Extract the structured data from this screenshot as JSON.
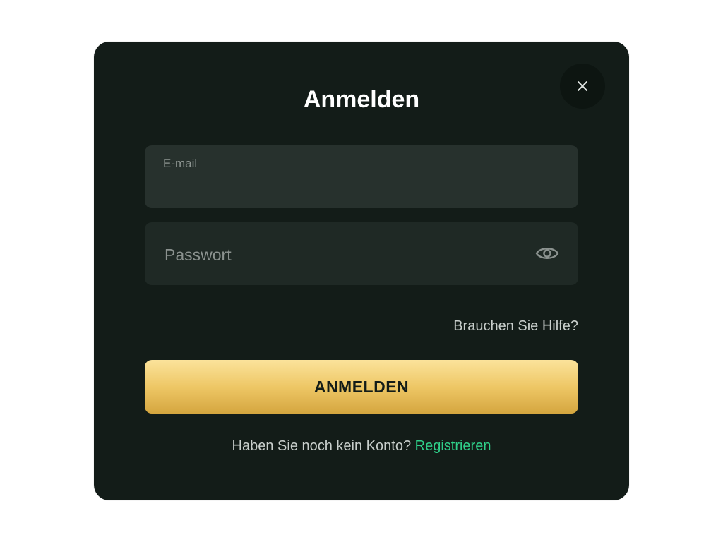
{
  "modal": {
    "title": "Anmelden",
    "close_icon": "close-icon"
  },
  "email": {
    "label": "E-mail",
    "value": "",
    "placeholder": ""
  },
  "password": {
    "value": "",
    "placeholder": "Passwort",
    "toggle_icon": "eye-icon"
  },
  "help": {
    "label": "Brauchen Sie Hilfe?"
  },
  "submit": {
    "label": "ANMELDEN"
  },
  "register": {
    "prompt": "Haben Sie noch kein Konto?",
    "link_label": "Registrieren"
  },
  "colors": {
    "modal_background": "#131c18",
    "link_accent": "#2fd08a",
    "button_gold": "#eec766"
  }
}
